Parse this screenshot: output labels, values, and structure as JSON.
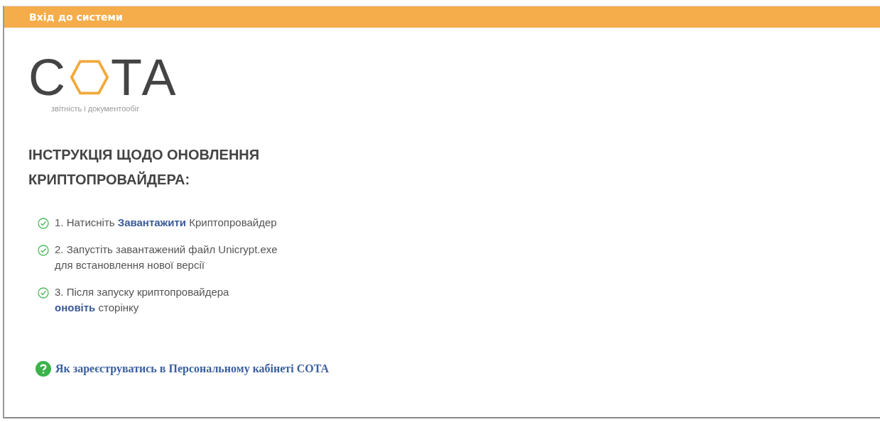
{
  "header": {
    "title": "Вхід до системи"
  },
  "logo": {
    "letters_before": "С",
    "letters_after": "ТА",
    "tagline": "звітність і документообіг"
  },
  "heading": "ІНСТРУКЦІЯ ЩОДО ОНОВЛЕННЯ КРИПТОПРОВАЙДЕРА:",
  "steps": [
    {
      "checked": true,
      "lines": [
        "1. Натисніть **Завантажити** Криптопровайдер"
      ]
    },
    {
      "checked": true,
      "lines": [
        "2. Запустіть завантажений файл Unicrypt.exe",
        "для встановлення нової версії"
      ]
    },
    {
      "checked": true,
      "lines": [
        "3. Після запуску криптопровайдера",
        "**оновіть** сторінку"
      ]
    }
  ],
  "help_link": "Як зареєструватись в Персональному кабінеті СОТА"
}
